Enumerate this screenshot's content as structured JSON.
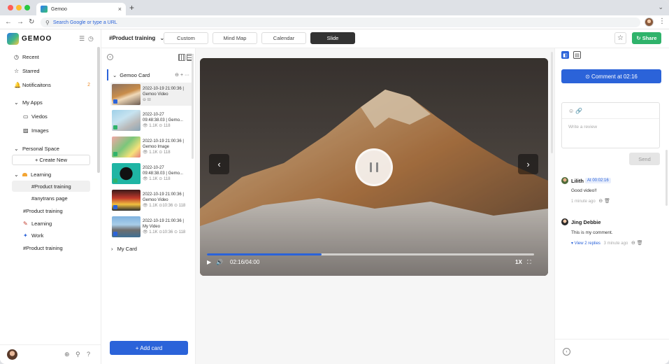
{
  "browser": {
    "tab_title": "Gemoo",
    "close_glyph": "×",
    "new_tab_glyph": "+",
    "menu_glyph": "⌄",
    "back_glyph": "←",
    "forward_glyph": "→",
    "reload_glyph": "↻",
    "search_glyph": "⚲",
    "omnibox_placeholder": "Search Google or type a URL",
    "kebab_glyph": "⋮",
    "dot_colors": [
      "#ff5f57",
      "#febc2e",
      "#28c840"
    ]
  },
  "app": {
    "brand": "GEMOO",
    "accent": "#2b63d9",
    "share_color": "#2fb36b"
  },
  "sidebar": {
    "collapse_glyph": "☰",
    "history_glyph": "◷",
    "items": [
      {
        "icon": "◷",
        "label": "Recent"
      },
      {
        "icon": "☆",
        "label": "Starred"
      },
      {
        "icon": "🔔",
        "label": "Notificaitons",
        "badge": "2"
      },
      {
        "icon": "⌄",
        "label": "My Apps"
      },
      {
        "icon": "▭",
        "label": "Viedos"
      },
      {
        "icon": "▨",
        "label": "Images"
      },
      {
        "icon": "⌄",
        "label": "Personal Space"
      },
      {
        "icon": "⌄",
        "label": "Learning"
      },
      {
        "icon": "",
        "label": "#Product training"
      },
      {
        "icon": "",
        "label": "#anytrans page"
      },
      {
        "icon": "",
        "label": "#Product training"
      },
      {
        "icon": "",
        "label": "Learning"
      },
      {
        "icon": "",
        "label": "Work"
      },
      {
        "icon": "",
        "label": "#Product training"
      }
    ],
    "create_new": "+ Create New",
    "footer_icons": [
      "⊕",
      "⚲",
      "?"
    ]
  },
  "toolbar": {
    "project": "#Product training",
    "project_chevron": "⌄",
    "tabs": [
      "Custom",
      "Mind Map",
      "Calendar",
      "Slide"
    ],
    "active_tab": "Slide",
    "star_glyph": "☆",
    "share_icon": "↻",
    "share": "Share"
  },
  "cards": {
    "back_glyph": "‹",
    "group_chevron": "⌄",
    "group_name": "Gemoo Card",
    "group_icons": "⊖ + ···",
    "items": [
      {
        "line1": "2022-10-19 21:00:36 |",
        "line2": "Gemoo Video",
        "stats": "⊖ ⊟"
      },
      {
        "line1": "2022-10-27",
        "line2": "09:48:38.03 | Gemo...",
        "stats": "👁 1.1K  ⊙ 118"
      },
      {
        "line1": "2022-10-19 21:00:36 |",
        "line2": "Gemoo Image",
        "stats": "👁 1.1K  ⊙ 118"
      },
      {
        "line1": "2022-10-27",
        "line2": "09:48:38.03 | Gemo...",
        "stats": "👁 1.1K  ⊙ 118"
      },
      {
        "line1": "2022-10-19 21:00:36 |",
        "line2": "Gemoo Video",
        "stats": "👁 1.1K  ⊙10:36  ⊙ 118"
      },
      {
        "line1": "2022-10-19 21:00:36 |",
        "line2": "My Video",
        "stats": "👁 1.1K  ⊙10:36  ⊙ 118"
      }
    ],
    "footer_chevron": "›",
    "footer_group": "My Card",
    "add_card": "+ Add card"
  },
  "player": {
    "progress": 0.35,
    "prev_glyph": "‹",
    "next_glyph": "›",
    "play_glyph": "▶",
    "volume_glyph": "🔊",
    "time": "02:16/04:00",
    "speed": "1X",
    "fullscreen_glyph": "⛶"
  },
  "comments": {
    "tab_1": "◧",
    "tab_2": "▤",
    "comment_at": "⊙  Comment at 02:16",
    "review_tools": "☺  🔗",
    "placeholder": "Write a review",
    "send": "Send",
    "items": [
      {
        "name": "Lilith",
        "stamp": "At 00:02:16",
        "text": "Good video!!",
        "meta": "1 minute ago",
        "icons": "⊖ 🗑"
      },
      {
        "name": "Jing Debbie",
        "text": "This is my comment.",
        "reply": "▾ View 2 replies",
        "meta": "3 minute ago",
        "icons": "⊖ 🗑"
      }
    ],
    "footer_glyph": "‹"
  }
}
